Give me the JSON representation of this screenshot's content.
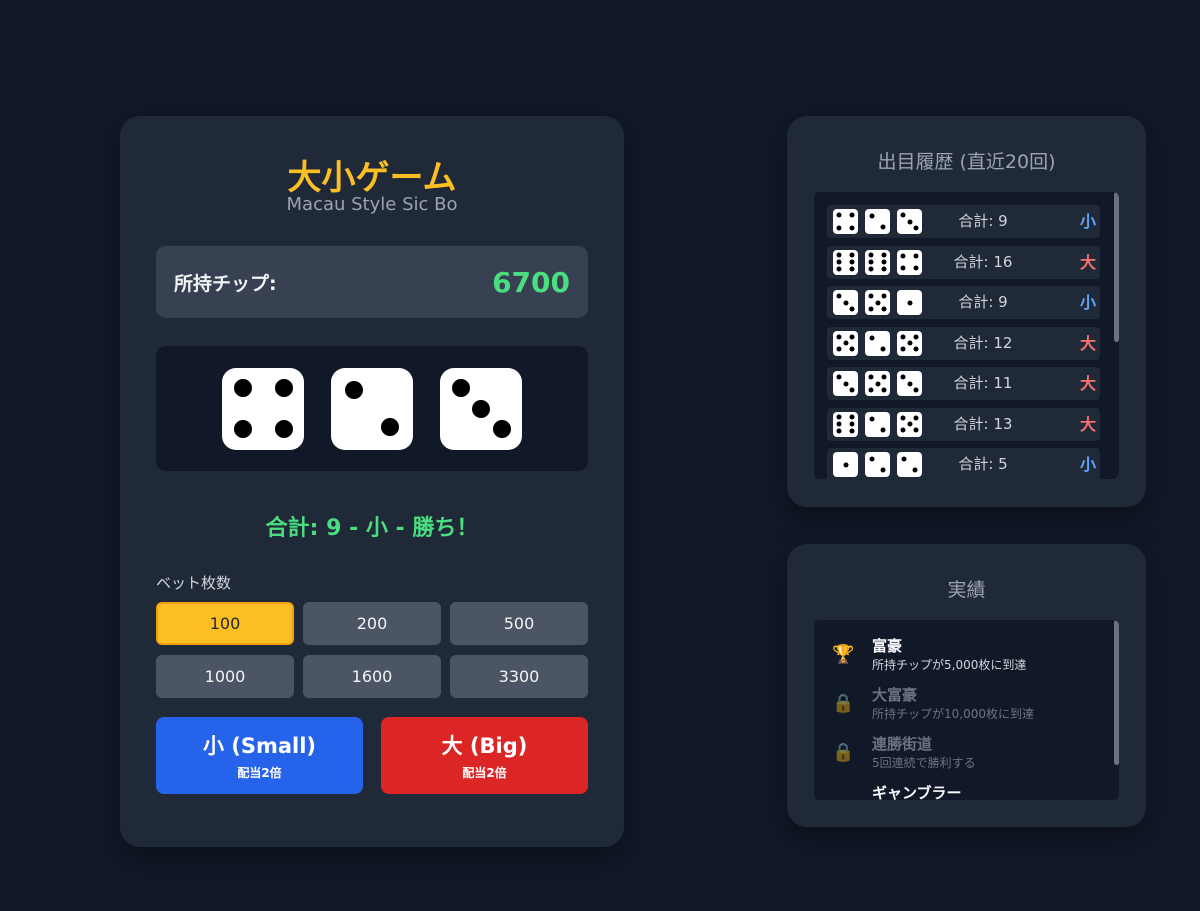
{
  "game": {
    "title": "大小ゲーム",
    "subtitle": "Macau Style Sic Bo",
    "chips_label": "所持チップ:",
    "chips_value": "6700",
    "dice": [
      4,
      2,
      3
    ],
    "result_text": "合計: 9 - 小 - 勝ち！",
    "bet_label": "ベット枚数",
    "bet_options": [
      "100",
      "200",
      "500",
      "1000",
      "1600",
      "3300"
    ],
    "selected_bet": "100",
    "small_button": {
      "label": "小 (Small)",
      "payout": "配当2倍",
      "color": "#2563eb"
    },
    "big_button": {
      "label": "大 (Big)",
      "payout": "配当2倍",
      "color": "#dc2626"
    }
  },
  "history": {
    "title": "出目履歴 (直近20回)",
    "rows": [
      {
        "dice": [
          4,
          2,
          3
        ],
        "sum": "合計: 9",
        "result": "小"
      },
      {
        "dice": [
          6,
          6,
          4
        ],
        "sum": "合計: 16",
        "result": "大"
      },
      {
        "dice": [
          3,
          5,
          1
        ],
        "sum": "合計: 9",
        "result": "小"
      },
      {
        "dice": [
          5,
          2,
          5
        ],
        "sum": "合計: 12",
        "result": "大"
      },
      {
        "dice": [
          3,
          5,
          3
        ],
        "sum": "合計: 11",
        "result": "大"
      },
      {
        "dice": [
          6,
          2,
          5
        ],
        "sum": "合計: 13",
        "result": "大"
      },
      {
        "dice": [
          1,
          2,
          2
        ],
        "sum": "合計: 5",
        "result": "小"
      }
    ]
  },
  "achievements": {
    "title": "実績",
    "items": [
      {
        "name": "富豪",
        "desc": "所持チップが5,000枚に到達",
        "unlocked": true,
        "icon": "trophy-icon"
      },
      {
        "name": "大富豪",
        "desc": "所持チップが10,000枚に到達",
        "unlocked": false,
        "icon": "lock-icon"
      },
      {
        "name": "連勝街道",
        "desc": "5回連続で勝利する",
        "unlocked": false,
        "icon": "lock-icon"
      },
      {
        "name": "ギャンブラー",
        "desc": "",
        "unlocked": true,
        "icon": ""
      }
    ]
  },
  "colors": {
    "background": "#111827",
    "panel": "#1f2937",
    "accent_gold": "#fbbf24",
    "win_green": "#4ade80",
    "small_blue": "#60a5fa",
    "big_red": "#f87171"
  }
}
